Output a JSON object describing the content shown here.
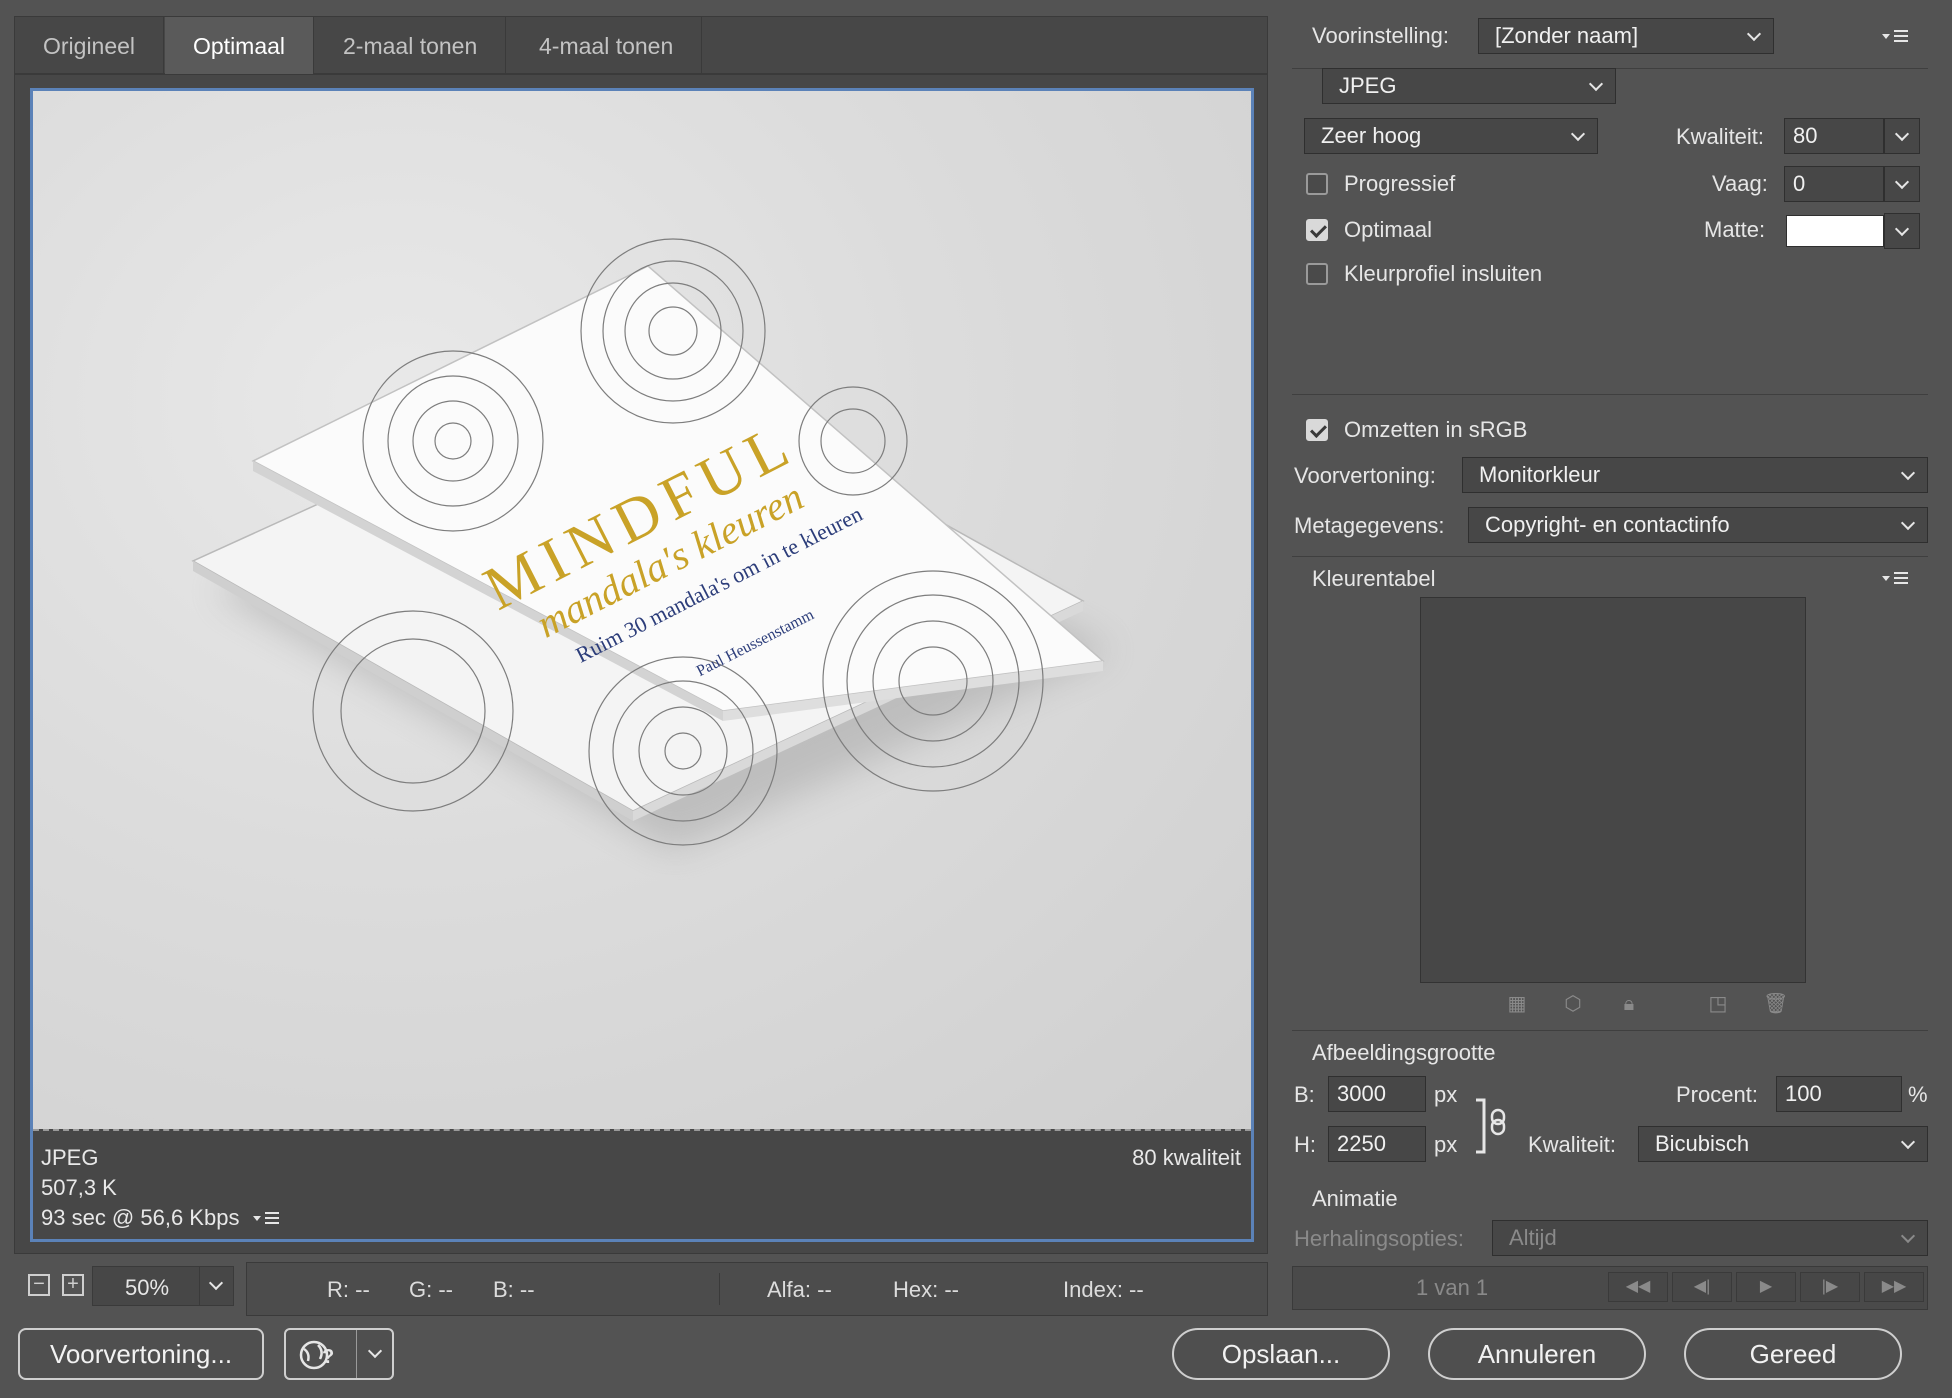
{
  "tabs": [
    {
      "label": "Origineel",
      "active": false
    },
    {
      "label": "Optimaal",
      "active": true
    },
    {
      "label": "2-maal tonen",
      "active": false
    },
    {
      "label": "4-maal tonen",
      "active": false
    }
  ],
  "preview": {
    "book": {
      "title": "MINDFUL",
      "subtitle": "mandala's kleuren",
      "tagline": "Ruim 30 mandala's om in te kleuren",
      "author": "Paul Heussenstamm"
    },
    "info": {
      "format": "JPEG",
      "size": "507,3 K",
      "download": "93 sec @ 56,6 Kbps",
      "quality": "80 kwaliteit"
    }
  },
  "status": {
    "zoom": "50%",
    "readouts": [
      "R: --",
      "G: --",
      "B: --",
      "Alfa: --",
      "Hex: --",
      "Index: --"
    ]
  },
  "buttons": {
    "preview": "Voorvertoning...",
    "save": "Opslaan...",
    "cancel": "Annuleren",
    "done": "Gereed"
  },
  "settings": {
    "preset_label": "Voorinstelling:",
    "preset_value": "[Zonder naam]",
    "format": "JPEG",
    "quality_preset": "Zeer hoog",
    "quality_label": "Kwaliteit:",
    "quality_value": "80",
    "blur_label": "Vaag:",
    "blur_value": "0",
    "matte_label": "Matte:",
    "matte_color": "#ffffff",
    "progressive": {
      "label": "Progressief",
      "checked": false
    },
    "optimized": {
      "label": "Optimaal",
      "checked": true
    },
    "embed_profile": {
      "label": "Kleurprofiel insluiten",
      "checked": false
    },
    "convert_srgb": {
      "label": "Omzetten in sRGB",
      "checked": true
    },
    "preview_label": "Voorvertoning:",
    "preview_value": "Monitorkleur",
    "metadata_label": "Metagegevens:",
    "metadata_value": "Copyright- en contactinfo"
  },
  "color_table": {
    "title": "Kleurentabel"
  },
  "image_size": {
    "title": "Afbeeldingsgrootte",
    "w_label": "B:",
    "w_value": "3000",
    "h_label": "H:",
    "h_value": "2250",
    "unit": "px",
    "percent_label": "Procent:",
    "percent_value": "100",
    "percent_unit": "%",
    "quality_label": "Kwaliteit:",
    "quality_value": "Bicubisch"
  },
  "animation": {
    "title": "Animatie",
    "loop_label": "Herhalingsopties:",
    "loop_value": "Altijd",
    "frame": "1 van 1"
  },
  "colors": {
    "accent": "#5b82b8",
    "panel": "#535353",
    "gold": "#c9a227",
    "navy": "#2c3d7a"
  }
}
